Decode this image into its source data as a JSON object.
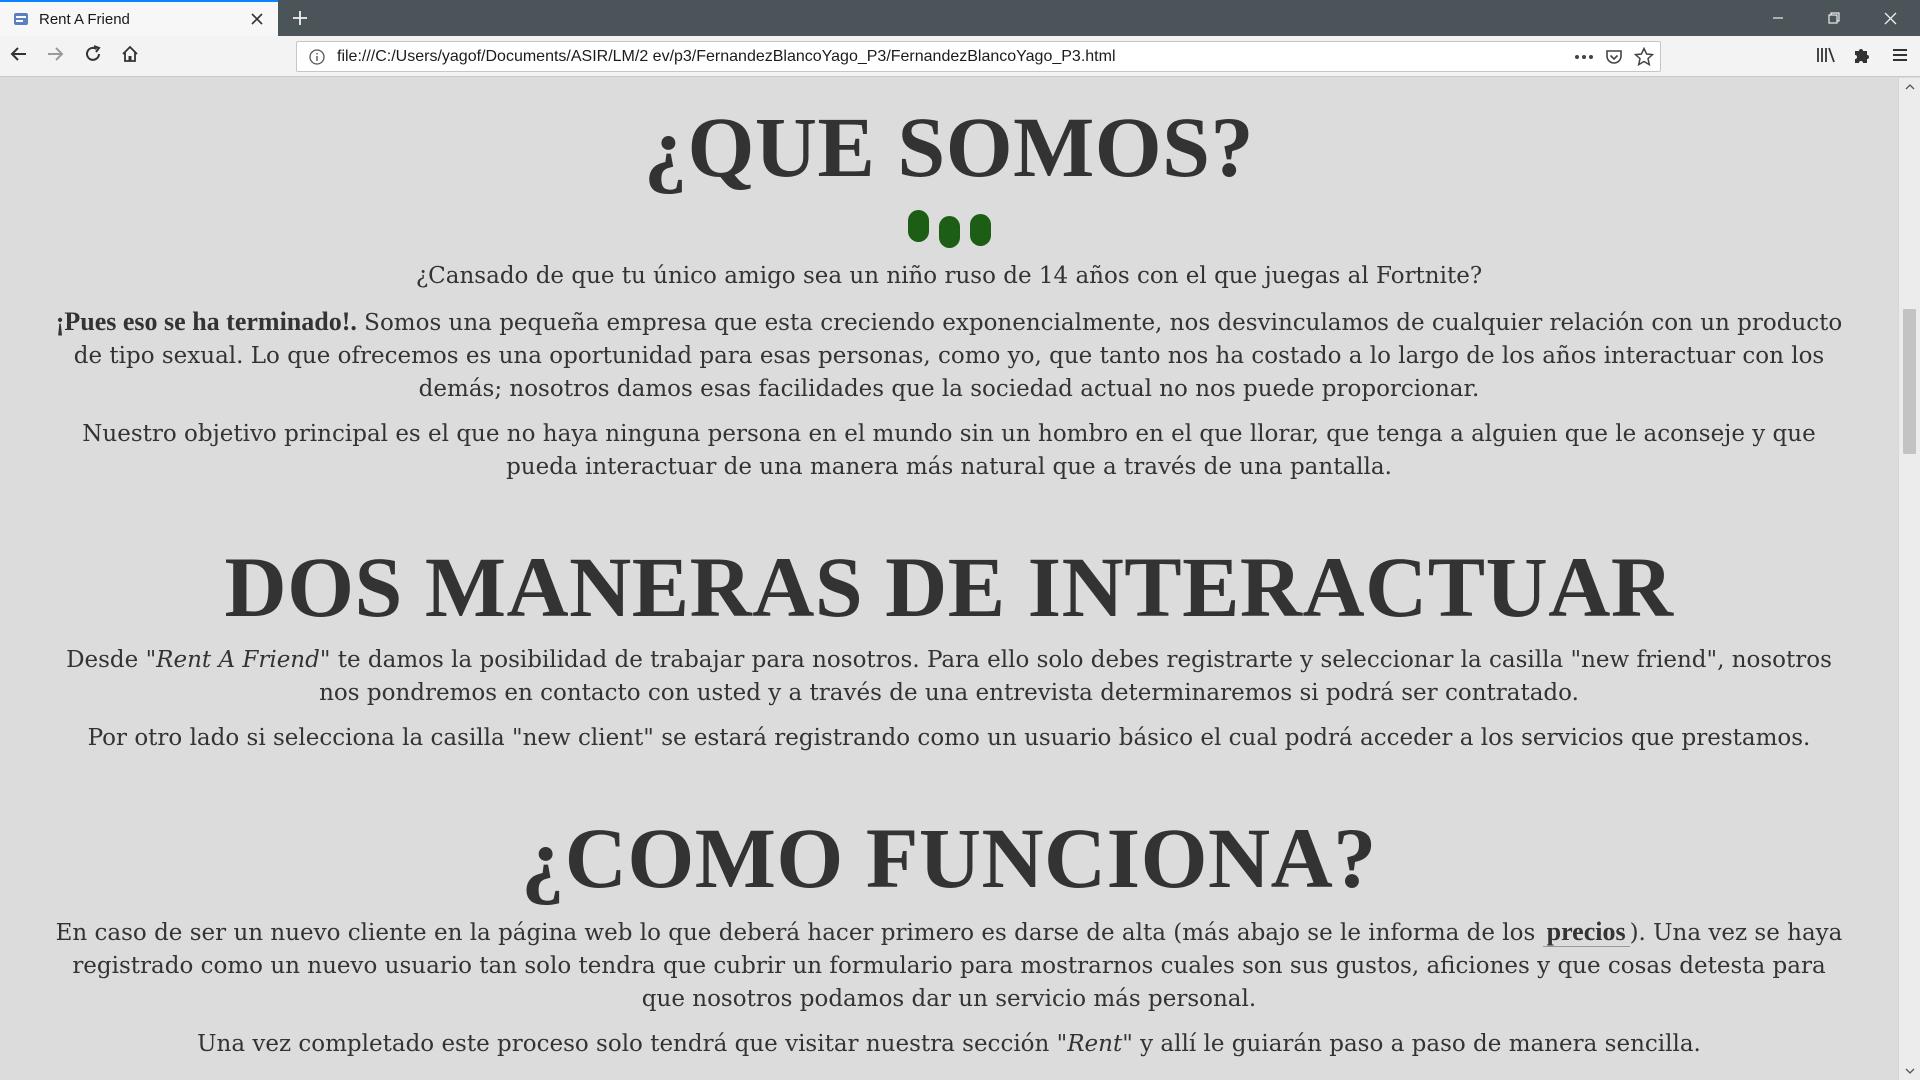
{
  "browser": {
    "tab_title": "Rent A Friend",
    "url": "file:///C:/Users/yagof/Documents/ASIR/LM/2 ev/p3/FernandezBlancoYago_P3/FernandezBlancoYago_P3.html",
    "icons": {
      "back": "arrow-left-icon",
      "forward": "arrow-right-icon",
      "reload": "reload-icon",
      "home": "home-icon",
      "info": "info-icon",
      "page_actions": "more-icon",
      "pocket": "pocket-icon",
      "bookmark": "star-icon",
      "library": "library-icon",
      "extensions": "puzzle-icon",
      "menu": "hamburger-icon"
    },
    "colors": {
      "tab_accent": "#0a84ff",
      "tabstrip": "#4a5459"
    }
  },
  "page": {
    "background": "#dcdcdc",
    "dot_color": "#1d5e16",
    "section1": {
      "title": "¿QUE SOMOS?",
      "intro": "¿Cansado de que tu único amigo sea un niño ruso de 14 años con el que juegas al Fortnite?",
      "p2_strong": "¡Pues eso se ha terminado!.",
      "p2_text": " Somos una pequeña empresa que esta creciendo exponencialmente, nos desvinculamos de cualquier relación con un producto de tipo sexual. Lo que ofrecemos es una oportunidad para esas personas, como yo, que tanto nos ha costado a lo largo de los años interactuar con los demás; nosotros damos esas facilidades que la sociedad actual no nos puede proporcionar.",
      "p3": "Nuestro objetivo principal es el que no haya ninguna persona en el mundo sin un hombro en el que llorar, que tenga a alguien que le aconseje y que pueda interactuar de una manera más natural que a través de una pantalla."
    },
    "section2": {
      "title": "DOS MANERAS DE INTERACTUAR",
      "p1_a": "Desde ",
      "p1_em": "\"Rent A Friend\"",
      "p1_b": " te damos la posibilidad de trabajar para nosotros. Para ello solo debes registrarte y seleccionar la casilla \"new friend\", nosotros nos pondremos en contacto con usted y a través de una entrevista determinaremos si podrá ser contratado.",
      "p2": "Por otro lado si selecciona la casilla \"new client\" se estará registrando como un usuario básico el cual podrá acceder a los servicios que prestamos."
    },
    "section3": {
      "title": "¿COMO FUNCIONA?",
      "p1_a": "En caso de ser un nuevo cliente en la página web lo que deberá hacer primero es darse de alta (más abajo se le informa de los ",
      "p1_link": "precios",
      "p1_b": "). Una vez se haya registrado como un nuevo usuario tan solo tendra que cubrir un formulario para mostrarnos cuales son sus gustos, aficiones y que cosas detesta para que nosotros podamos dar un servicio más personal.",
      "p2_a": "Una vez completado este proceso solo tendrá que visitar nuestra sección ",
      "p2_em": "\"Rent\"",
      "p2_b": " y allí le guiarán paso a paso de manera sencilla."
    }
  }
}
